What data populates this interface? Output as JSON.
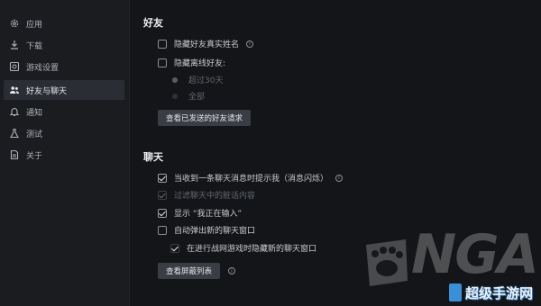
{
  "sidebar": {
    "items": [
      {
        "label": "应用",
        "icon": "gear-icon"
      },
      {
        "label": "下载",
        "icon": "download-icon"
      },
      {
        "label": "游戏设置",
        "icon": "gamepad-icon"
      },
      {
        "label": "好友与聊天",
        "icon": "friends-icon",
        "active": true
      },
      {
        "label": "通知",
        "icon": "bell-icon"
      },
      {
        "label": "测试",
        "icon": "flask-icon"
      },
      {
        "label": "关于",
        "icon": "document-icon"
      }
    ]
  },
  "friends": {
    "title": "好友",
    "hide_real_name": {
      "label": "隐藏好友真实姓名",
      "checked": false
    },
    "hide_offline": {
      "label": "隐藏离线好友:",
      "checked": false
    },
    "offline_over_30": {
      "label": "超过30天"
    },
    "offline_all": {
      "label": "全部"
    },
    "sent_requests_button": "查看已发送的好友请求"
  },
  "chat": {
    "title": "聊天",
    "notify_on_message": {
      "label": "当收到一条聊天消息时提示我（消息闪烁）",
      "checked": true
    },
    "filter_chat": {
      "label": "过滤聊天中的脏话内容",
      "checked": true,
      "disabled": true
    },
    "show_typing": {
      "label": "显示 “我正在输入”",
      "checked": true
    },
    "auto_popup": {
      "label": "自动弹出新的聊天窗口",
      "checked": false
    },
    "hide_in_battle": {
      "label": "在进行战网游戏时隐藏新的聊天窗口",
      "checked": true
    },
    "block_list_button": "查看屏蔽列表"
  },
  "watermark": {
    "text": "NGA",
    "site_logo": "超级手游网"
  },
  "colors": {
    "background": "#131518",
    "sidebar": "#1a1c20",
    "active_item": "#2a2d33",
    "button": "#3a3d43"
  }
}
